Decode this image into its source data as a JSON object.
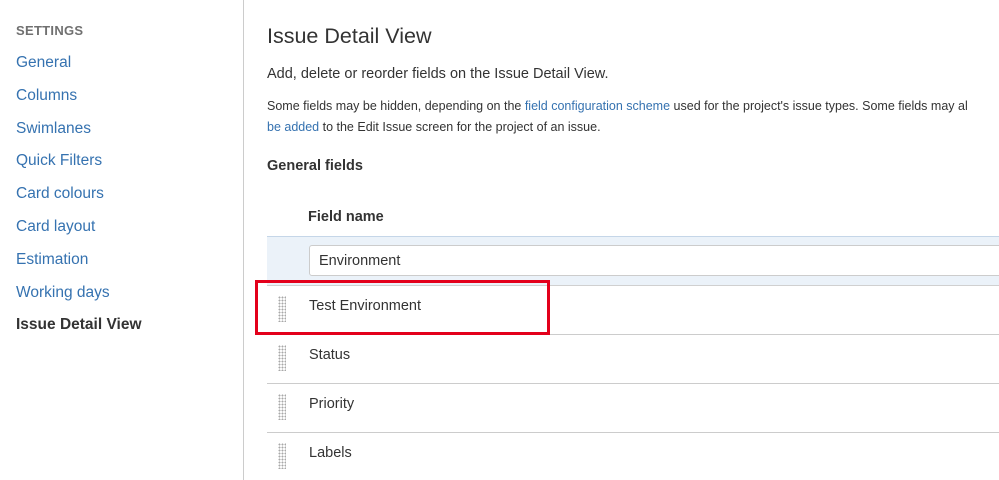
{
  "sidebar": {
    "heading": "SETTINGS",
    "items": [
      {
        "label": "General"
      },
      {
        "label": "Columns"
      },
      {
        "label": "Swimlanes"
      },
      {
        "label": "Quick Filters"
      },
      {
        "label": "Card colours"
      },
      {
        "label": "Card layout"
      },
      {
        "label": "Estimation"
      },
      {
        "label": "Working days"
      },
      {
        "label": "Issue Detail View"
      }
    ]
  },
  "main": {
    "title": "Issue Detail View",
    "lead": "Add, delete or reorder fields on the Issue Detail View.",
    "description": {
      "part1": "Some fields may be hidden, depending on the ",
      "link1": "field configuration scheme",
      "part2": " used for the project's issue types. Some fields may al",
      "link2": "be added",
      "part3": " to the Edit Issue screen for the project of an issue."
    },
    "section_title": "General fields",
    "column_header": "Field name",
    "add_field": {
      "value": "Environment"
    },
    "fields": [
      {
        "name": "Test Environment"
      },
      {
        "name": "Status"
      },
      {
        "name": "Priority"
      },
      {
        "name": "Labels"
      }
    ],
    "highlight_color": "#e3001b"
  }
}
